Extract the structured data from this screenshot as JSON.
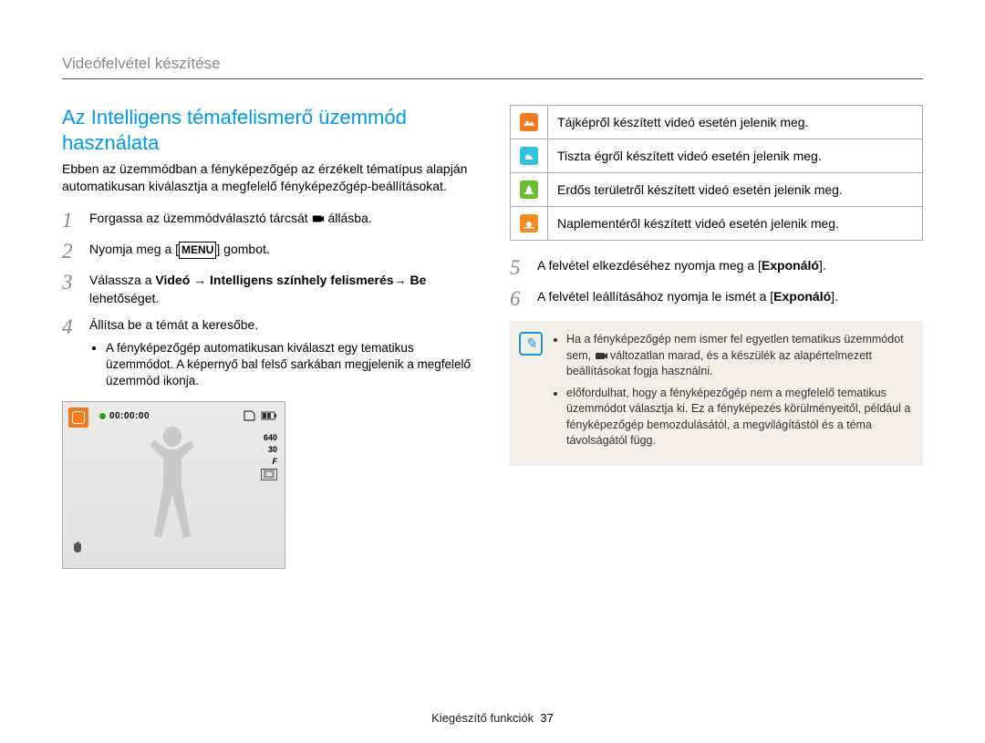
{
  "breadcrumb": "Videófelvétel készítése",
  "title": "Az Intelligens témafelismerő üzemmód használata",
  "intro": "Ebben az üzemmódban a fényképezőgép az érzékelt tématípus alapján automatikusan kiválasztja a megfelelő fényképezőgép-beállításokat.",
  "steps": {
    "s1": {
      "n": "1",
      "pre": "Forgassa az üzemmódválasztó tárcsát ",
      "post": " állásba."
    },
    "s2": {
      "n": "2",
      "pre": "Nyomja meg a ",
      "menu": "MENU",
      "post": " gombot."
    },
    "s3": {
      "n": "3",
      "text_a": "Válassza a ",
      "b1": "Videó",
      "arrow1": " → ",
      "b2": "Intelligens színhely felismerés",
      "arrow2": "→ ",
      "b3": "Be",
      "tail": " lehetőséget."
    },
    "s4": {
      "n": "4",
      "text": "Állítsa be a témát a keresőbe.",
      "bullet": "A fényképezőgép automatikusan kiválaszt egy tematikus üzemmódot. A képernyő bal felső sarkában megjelenik a megfelelő üzemmód ikonja."
    },
    "s5": {
      "n": "5",
      "pre": "A felvétel elkezdéséhez nyomja meg a [",
      "b": "Exponáló",
      "post": "]."
    },
    "s6": {
      "n": "6",
      "pre": "A felvétel leállításához nyomja le ismét a [",
      "b": "Exponáló",
      "post": "]."
    }
  },
  "lcd": {
    "time": "00:00:00",
    "res": "640",
    "fps": "30",
    "f": "F"
  },
  "table": {
    "r1": "Tájképről készített videó esetén jelenik meg.",
    "r2": "Tiszta égről készített videó esetén jelenik meg.",
    "r3": "Erdős területről készített videó esetén jelenik meg.",
    "r4": "Naplementéről készített videó esetén jelenik meg."
  },
  "info": {
    "b1a": "Ha a fényképezőgép nem ismer fel egyetlen tematikus üzemmódot sem, ",
    "b1b": " változatlan marad, és a készülék az alapértelmezett beállításokat fogja használni.",
    "b2": "előfordulhat, hogy a fényképezőgép nem a megfelelő tematikus üzemmódot választja ki. Ez a fényképezés körülményeitől, például a fényképezőgép bemozdulásától, a megvilágítástól és a téma távolságától függ."
  },
  "footer": {
    "label": "Kiegészítő funkciók",
    "page": "37"
  }
}
